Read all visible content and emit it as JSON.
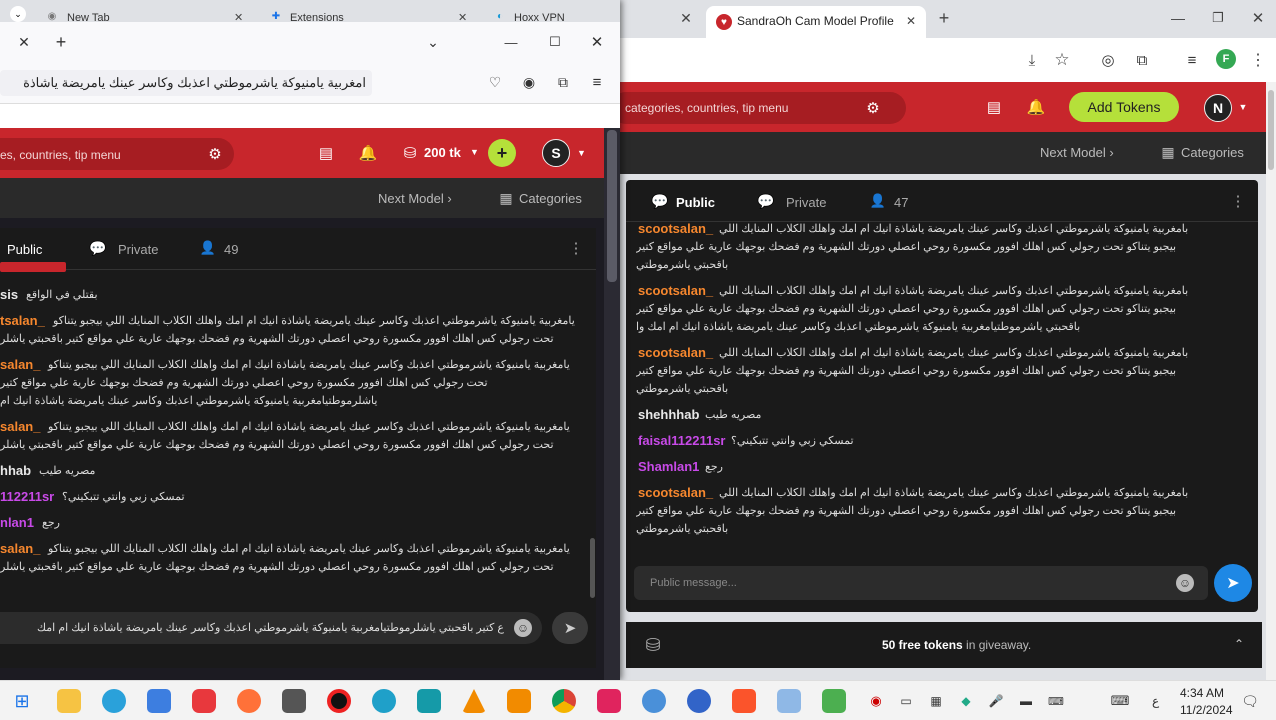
{
  "right": {
    "tab_title": "SandraOh Cam Model Profile |",
    "search_placeholder": "categories, countries, tip menu",
    "add_tokens": "Add Tokens",
    "avatar": "N",
    "next_model": "Next Model",
    "categories": "Categories",
    "tab_public": "Public",
    "tab_private": "Private",
    "viewers": "47",
    "message_placeholder": "Public message...",
    "giveaway_bold": "50 free tokens",
    "giveaway_rest": " in giveaway.",
    "profile_letter": "F",
    "messages": [
      {
        "user": "scootsalan_",
        "cls": "or",
        "lines": [
          "بامغربية يامنيوكة ياشرموطتي اعذبك وكاسر عينك يامريضة ياشاذة انيك ام امك واهلك الكلاب المنايك اللي",
          "بيجبو يتناكو تحت رجولي كس اهلك افوور مكسورة روحي اعصلي دورتك الشهرية وم فضحك بوجهك عارية علي مواقع كتير",
          "باقحبتي ياشرموطتي"
        ]
      },
      {
        "user": "scootsalan_",
        "cls": "or",
        "lines": [
          "بامغربية يامنيوكة ياشرموطتي اعذبك وكاسر عينك يامريضة ياشاذة انيك ام امك واهلك الكلاب المنايك اللي",
          "بيجبو يتناكو تحت رجولي كس اهلك افوور مكسورة روحي اعصلي دورتك الشهرية وم فضحك بوجهك عارية علي مواقع كتير",
          "باقحبتي ياشرموطتيامغربية يامنيوكة ياشرموطتي اعذبك وكاسر عينك يامريضة ياشاذة انيك ام امك وا"
        ]
      },
      {
        "user": "scootsalan_",
        "cls": "or",
        "lines": [
          "بامغربية يامنيوكة ياشرموطتي اعذبك وكاسر عينك يامريضة ياشاذة انيك ام امك واهلك الكلاب المنايك اللي",
          "بيجبو يتناكو تحت رجولي كس اهلك افوور مكسورة روحي اعصلي دورتك الشهرية وم فضحك بوجهك عارية علي مواقع كتير",
          "باقحبتي ياشرموطتي"
        ]
      },
      {
        "user": "shehhhab",
        "cls": "wt",
        "lines": [
          "مصريه طيب"
        ]
      },
      {
        "user": "faisal112211sr",
        "cls": "pu",
        "lines": [
          "تمسكي زبي وانتي تتبكيني؟"
        ]
      },
      {
        "user": "Shamlan1",
        "cls": "pu",
        "lines": [
          "رجع"
        ]
      },
      {
        "user": "scootsalan_",
        "cls": "or",
        "lines": [
          "بامغربية يامنيوكة ياشرموطتي اعذبك وكاسر عينك يامريضة ياشاذة انيك ام امك واهلك الكلاب المنايك اللي",
          "بيجبو يتناكو تحت رجولي كس اهلك افوور مكسورة روحي اعصلي دورتك الشهرية وم فضحك بوجهك عارية علي مواقع كتير",
          "باقحبتي ياشرموطتي"
        ]
      }
    ]
  },
  "left": {
    "tabs": [
      "New Tab",
      "Extensions",
      "Hoxx VPN"
    ],
    "url_text": "امغربية يامنيوكة ياشرموطتي اعذبك وكاسر عينك يامريضة ياشاذة",
    "search_placeholder": "es, countries, tip menu",
    "tokens": "200 tk",
    "avatar": "S",
    "next_model": "Next Model",
    "categories": "Categories",
    "tab_public": "Public",
    "tab_private": "Private",
    "viewers": "49",
    "input_text": "ع كتير باقحبتي ياشلرموطتيامغربية يامنيوكة ياشرموطتي اعذبك وكاسر عينك يامريضة ياشاذة انيك ام امك",
    "messages": [
      {
        "user": "sis",
        "cls": "wt",
        "lines": [
          "بقتلي في الواقع"
        ]
      },
      {
        "user": "tsalan_",
        "cls": "or",
        "lines": [
          "يامغربية يامنيوكة ياشرموطتي اعذبك وكاسر عينك يامريضة ياشاذة انيك ام امك واهلك الكلاب المنايك اللي بيجبو يتناكو",
          "تحت رجولي كس اهلك افوور مكسورة روحي اعصلي دورتك الشهرية وم فضحك بوجهك عارية علي مواقع كتير باقحبتي ياشلر"
        ]
      },
      {
        "user": "salan_",
        "cls": "or",
        "lines": [
          "يامغربية يامنيوكة ياشرموطتي اعذبك وكاسر عينك يامريضة ياشاذة انيك ام امك واهلك الكلاب المنايك اللي بيجبو يتناكو",
          "تحت رجولي كس اهلك افوور مكسورة روحي اعصلي دورتك الشهرية وم فضحك بوجهك عارية علي مواقع كتير",
          "ياشلرموطتيامغربية يامنيوكة ياشرموطتي اعذبك وكاسر عينك يامريضة ياشاذة انيك ام"
        ]
      },
      {
        "user": "salan_",
        "cls": "or",
        "lines": [
          "يامغربية يامنيوكة ياشرموطتي اعذبك وكاسر عينك يامريضة ياشاذة انيك ام امك واهلك الكلاب المنايك اللي بيجبو يتناكو",
          "تحت رجولي كس اهلك افوور مكسورة روحي اعصلي دورتك الشهرية وم فضحك بوجهك عارية علي مواقع كتير باقحبتي ياشلر"
        ]
      },
      {
        "user": "hhab",
        "cls": "wt",
        "lines": [
          "مصريه طيب"
        ]
      },
      {
        "user": "112211sr",
        "cls": "pu",
        "lines": [
          "تمسكي زبي وانتي تتبكيني؟"
        ]
      },
      {
        "user": "nlan1",
        "cls": "pu",
        "lines": [
          "رجع"
        ]
      },
      {
        "user": "salan_",
        "cls": "or",
        "lines": [
          "يامغربية يامنيوكة ياشرموطتي اعذبك وكاسر عينك يامريضة ياشاذة انيك ام امك واهلك الكلاب المنايك اللي بيجبو يتناكو",
          "تحت رجولي كس اهلك افوور مكسورة روحي اعصلي دورتك الشهرية وم فضحك بوجهك عارية علي مواقع كتير باقحبتي ياشلر"
        ]
      }
    ]
  },
  "taskbar": {
    "time": "4:34 AM",
    "date": "11/2/2024",
    "lang": "ع"
  },
  "colors": {
    "brand_red": "#c8262c",
    "add_tokens": "#b5e03a",
    "send_blue": "#1e88e5"
  }
}
